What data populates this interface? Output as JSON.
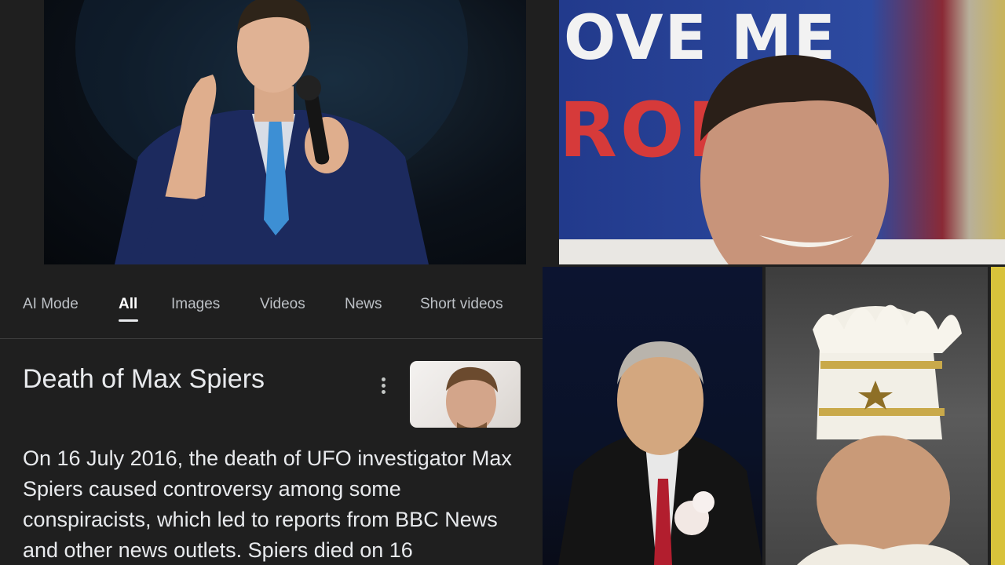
{
  "photos": {
    "sign_text_top": "OVE ME",
    "sign_text_red": "ROI"
  },
  "tabs": [
    {
      "label": "AI Mode",
      "active": false
    },
    {
      "label": "All",
      "active": true
    },
    {
      "label": "Images",
      "active": false
    },
    {
      "label": "Videos",
      "active": false
    },
    {
      "label": "News",
      "active": false
    },
    {
      "label": "Short videos",
      "active": false
    }
  ],
  "knowledge_panel": {
    "title": "Death of Max Spiers",
    "more_icon": "more-vert-icon",
    "description": "On 16 July 2016, the death of UFO investigator Max Spiers caused controversy among some conspiracists, which led to reports from BBC News and other news outlets. Spiers died on 16"
  },
  "colors": {
    "background": "#1f1f1f",
    "text_primary": "#e8eaed",
    "text_secondary": "#bdc1c6",
    "divider": "#3c3c3c"
  }
}
